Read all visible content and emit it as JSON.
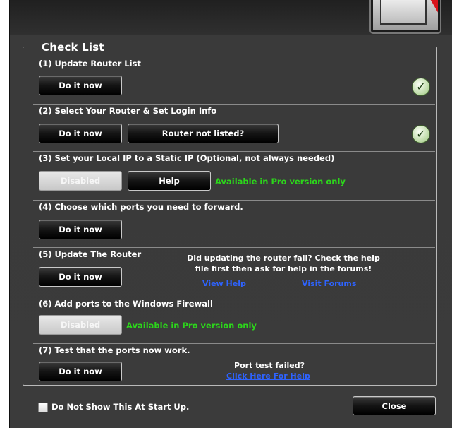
{
  "checklist": {
    "title": "Check List",
    "sections": [
      {
        "title": "(1) Update Router List",
        "buttons": [
          "Do it now"
        ],
        "status": "complete"
      },
      {
        "title": "(2) Select Your Router & Set Login Info",
        "buttons": [
          "Do it now",
          "Router not listed?"
        ],
        "status": "complete"
      },
      {
        "title": "(3) Set your Local IP to a Static IP (Optional, not always needed)",
        "buttons": [
          "Disabled",
          "Help"
        ],
        "note": "Available in Pro version only"
      },
      {
        "title": "(4) Choose which ports you need to forward.",
        "buttons": [
          "Do it now"
        ]
      },
      {
        "title": "(5) Update The Router",
        "buttons": [
          "Do it now"
        ],
        "help_text_line1": "Did updating the router fail? Check the help",
        "help_text_line2": "file first then ask for help in the forums!",
        "links": [
          "View Help",
          "Visit Forums"
        ]
      },
      {
        "title": "(6) Add ports to the Windows Firewall",
        "buttons": [
          "Disabled"
        ],
        "note": "Available in Pro version only"
      },
      {
        "title": "(7) Test that the ports now work.",
        "buttons": [
          "Do it now"
        ],
        "help_text": "Port test failed?",
        "link": "Click Here For Help"
      }
    ]
  },
  "footer": {
    "checkbox_label": "Do Not Show This At Start Up.",
    "checkbox_checked": false,
    "close_label": "Close"
  },
  "colors": {
    "pro_note": "#2cd51b",
    "link": "#2e63ff",
    "background": "#3a3a3a"
  },
  "icons": [
    "checkmark-icon",
    "app-logo-icon"
  ]
}
